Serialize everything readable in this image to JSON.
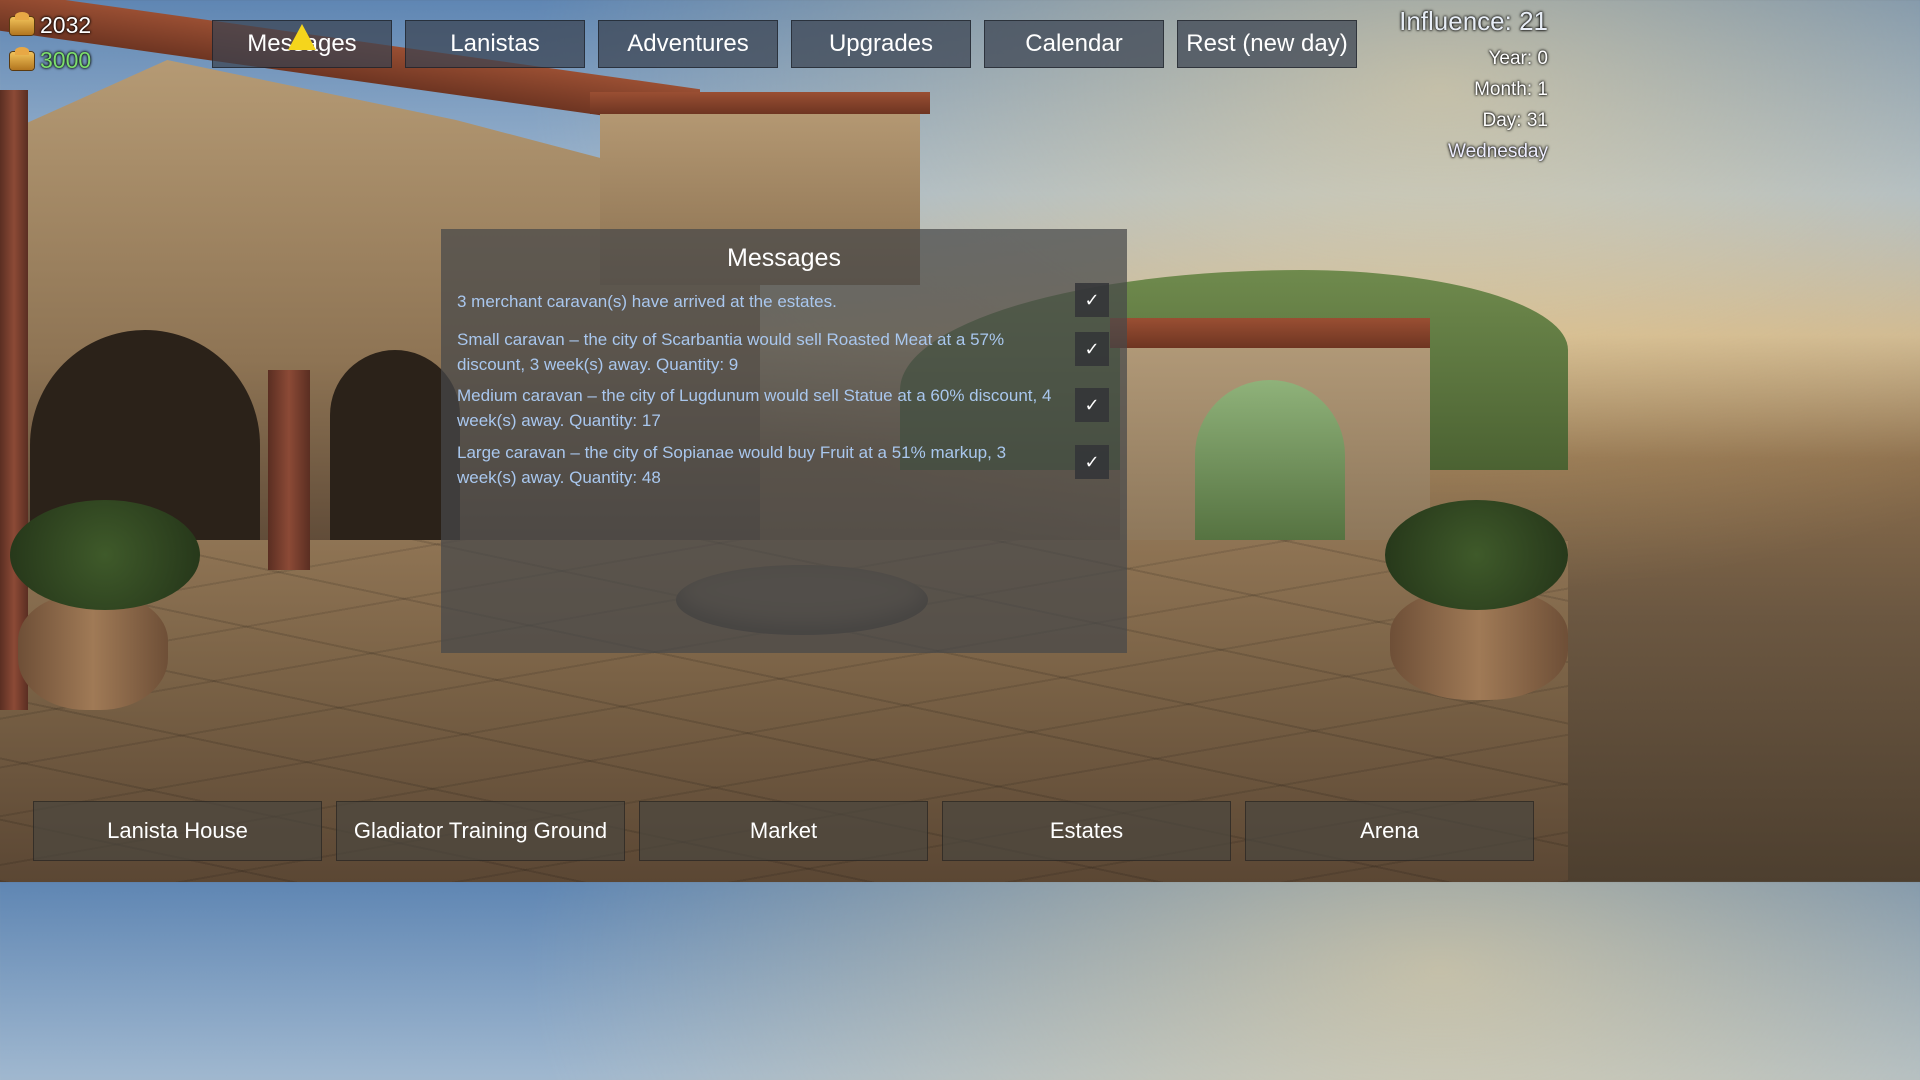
{
  "resources": {
    "gold": "2032",
    "food": "3000",
    "food_color": "#7ddf6c"
  },
  "topnav": [
    "Messages",
    "Lanistas",
    "Adventures",
    "Upgrades",
    "Calendar",
    "Rest (new day)"
  ],
  "date": {
    "influence": "Influence: 21",
    "year": "Year: 0",
    "month": "Month: 1",
    "day": "Day: 31",
    "weekday": "Wednesday"
  },
  "messages_panel": {
    "title": "Messages",
    "ack_label": "✓",
    "items": [
      "3 merchant caravan(s) have arrived at the estates.",
      "Small caravan – the city of Scarbantia would sell Roasted Meat at a 57% discount, 3 week(s) away. Quantity: 9",
      "Medium caravan – the city of Lugdunum would sell Statue at a 60% discount, 4 week(s) away. Quantity: 17",
      "Large caravan – the city of Sopianae would buy Fruit at a 51% markup, 3 week(s) away. Quantity: 48"
    ]
  },
  "bottomnav": [
    "Lanista House",
    "Gladiator Training Ground",
    "Market",
    "Estates",
    "Arena"
  ],
  "colors": {
    "message_text": "#a9c7ee",
    "cursor": "#f5d51c"
  }
}
